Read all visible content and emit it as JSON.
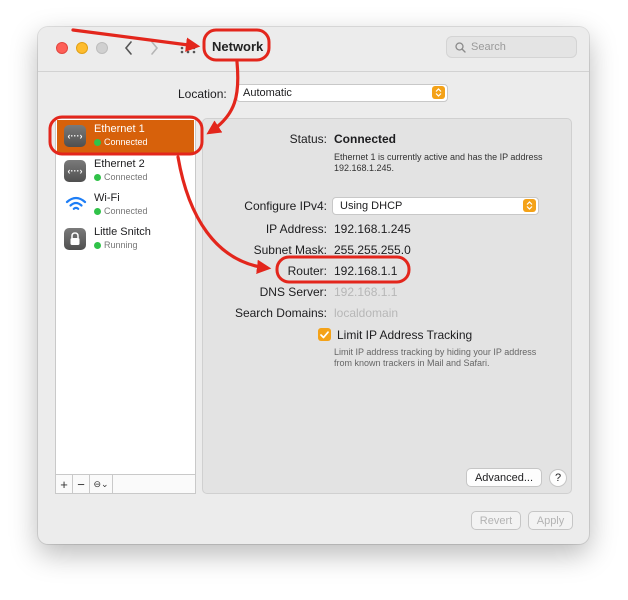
{
  "window": {
    "title": "Network",
    "search_placeholder": "Search"
  },
  "toolbar": {
    "icons": [
      "close-button",
      "minimize-button",
      "zoom-button",
      "chevron-left-icon",
      "chevron-right-icon",
      "show-all-grid-icon",
      "search-icon"
    ]
  },
  "location": {
    "label": "Location:",
    "value": "Automatic"
  },
  "sidebar": {
    "services": [
      {
        "name": "Ethernet 1",
        "status": "Connected",
        "icon": "ethernet-icon",
        "status_color": "#30c249",
        "selected": true
      },
      {
        "name": "Ethernet 2",
        "status": "Connected",
        "icon": "ethernet-icon",
        "status_color": "#30c249",
        "selected": false
      },
      {
        "name": "Wi-Fi",
        "status": "Connected",
        "icon": "wifi-icon",
        "status_color": "#30c249",
        "selected": false
      },
      {
        "name": "Little Snitch",
        "status": "Running",
        "icon": "lock-icon",
        "status_color": "#30c249",
        "selected": false
      }
    ],
    "footer": {
      "add": "+",
      "remove": "−",
      "action": "⊖⌄"
    }
  },
  "details": {
    "status_label": "Status:",
    "status_value": "Connected",
    "status_description": "Ethernet 1 is currently active and has the IP address 192.168.1.245.",
    "configure_label": "Configure IPv4:",
    "configure_value": "Using DHCP",
    "ip_label": "IP Address:",
    "ip_value": "192.168.1.245",
    "subnet_label": "Subnet Mask:",
    "subnet_value": "255.255.255.0",
    "router_label": "Router:",
    "router_value": "192.168.1.1",
    "dns_label": "DNS Server:",
    "dns_value": "192.168.1.1",
    "search_domains_label": "Search Domains:",
    "search_domains_value": "localdomain",
    "limit_tracking_label": "Limit IP Address Tracking",
    "limit_tracking_checked": true,
    "limit_tracking_description": "Limit IP address tracking by hiding your IP address from known trackers in Mail and Safari."
  },
  "buttons": {
    "advanced": "Advanced...",
    "help": "?",
    "revert": "Revert",
    "apply": "Apply"
  },
  "colors": {
    "accent": "#d7610b",
    "annotation": "#e3261c",
    "checkbox": "#f4a218",
    "status_green": "#30c249"
  }
}
